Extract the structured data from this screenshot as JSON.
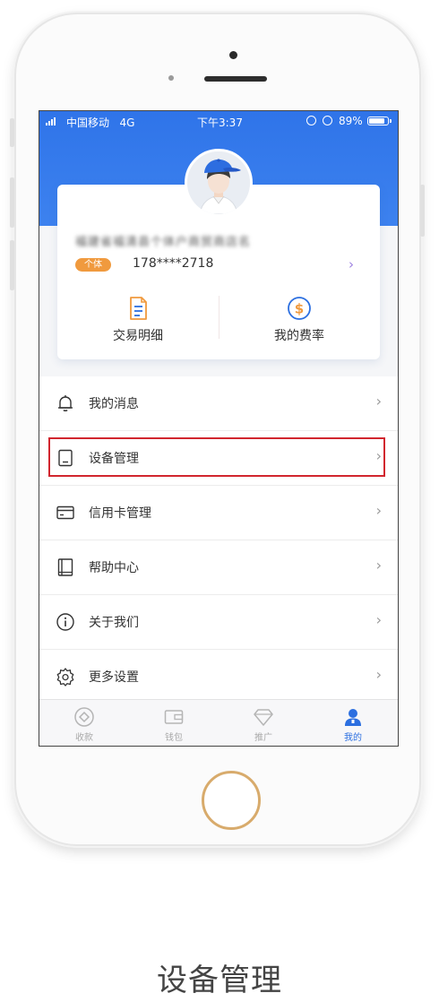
{
  "status_bar": {
    "carrier": "中国移动",
    "network": "4G",
    "time": "下午3:37",
    "battery": "89%"
  },
  "profile": {
    "merchant_name": "福建省福清县个体户商贸商店名",
    "merchant_type": "个体",
    "phone": "178****2718"
  },
  "quick_actions": [
    {
      "label": "交易明细",
      "icon": "document-icon"
    },
    {
      "label": "我的费率",
      "icon": "dollar-circle-icon"
    }
  ],
  "menu": [
    {
      "label": "我的消息",
      "icon": "bell-icon"
    },
    {
      "label": "设备管理",
      "icon": "device-icon",
      "highlighted": true
    },
    {
      "label": "信用卡管理",
      "icon": "credit-card-icon"
    },
    {
      "label": "帮助中心",
      "icon": "book-icon"
    },
    {
      "label": "关于我们",
      "icon": "info-icon"
    },
    {
      "label": "更多设置",
      "icon": "gear-icon"
    }
  ],
  "tabs": [
    {
      "label": "收款",
      "icon": "receive-icon",
      "active": false
    },
    {
      "label": "钱包",
      "icon": "wallet-icon",
      "active": false
    },
    {
      "label": "推广",
      "icon": "diamond-icon",
      "active": false
    },
    {
      "label": "我的",
      "icon": "person-icon",
      "active": true
    }
  ],
  "colors": {
    "header_blue": "#3d82ef",
    "tab_active": "#2c6fe0",
    "badge_orange": "#f09a3e",
    "highlight_red": "#d1262e",
    "home_ring": "#d8ab6c"
  },
  "caption": "设备管理"
}
